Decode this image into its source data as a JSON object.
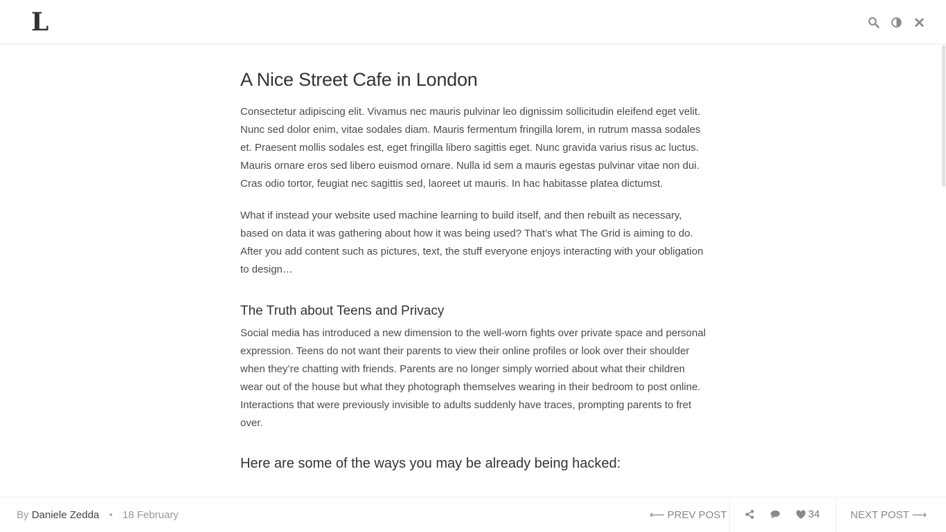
{
  "header": {
    "logo": "L",
    "icons": [
      "search-icon",
      "contrast-icon",
      "close-icon"
    ]
  },
  "article": {
    "title": "A Nice Street Cafe in London",
    "paragraphs": [
      "Consectetur adipiscing elit. Vivamus nec mauris pulvinar leo dignissim sollicitudin eleifend eget velit. Nunc sed dolor enim, vitae sodales diam. Mauris fermentum fringilla lorem, in rutrum massa sodales et. Praesent mollis sodales est, eget fringilla libero sagittis eget. Nunc gravida varius risus ac luctus. Mauris ornare eros sed libero euismod ornare. Nulla id sem a mauris egestas pulvinar vitae non dui. Cras odio tortor, feugiat nec sagittis sed, laoreet ut mauris. In hac habitasse platea dictumst.",
      "What if instead your website used machine learning to build itself, and then rebuilt as necessary, based on data it was gathering about how it was being used? That’s what The Grid is aiming to do. After you add content such as pictures, text, the stuff everyone enjoys interacting with your obligation to design…"
    ],
    "section_title": "The Truth about Teens and Privacy",
    "section_paragraph": "Social media has introduced a new dimension to the well-worn fights over private space and personal expression. Teens do not want their parents to view their online profiles or look over their shoulder when they’re chatting with friends. Parents are no longer simply worried about what their children wear out of the house but what they photograph themselves wearing in their bedroom to post online. Interactions that were previously invisible to adults suddenly have traces, prompting parents to fret over.",
    "subheading": "Here are some of the ways you may be already being hacked:"
  },
  "footer": {
    "by_label": "By",
    "author": "Daniele Zedda",
    "separator": "•",
    "date": "18 February",
    "prev_label": "⟵ PREV POST",
    "next_label": "NEXT POST ⟶",
    "likes_count": "34",
    "icons": [
      "share-icon",
      "comment-icon",
      "heart-icon"
    ]
  },
  "colors": {
    "text": "#333333",
    "muted": "#999999",
    "border": "#ececec",
    "icon": "#8a8a8a"
  }
}
